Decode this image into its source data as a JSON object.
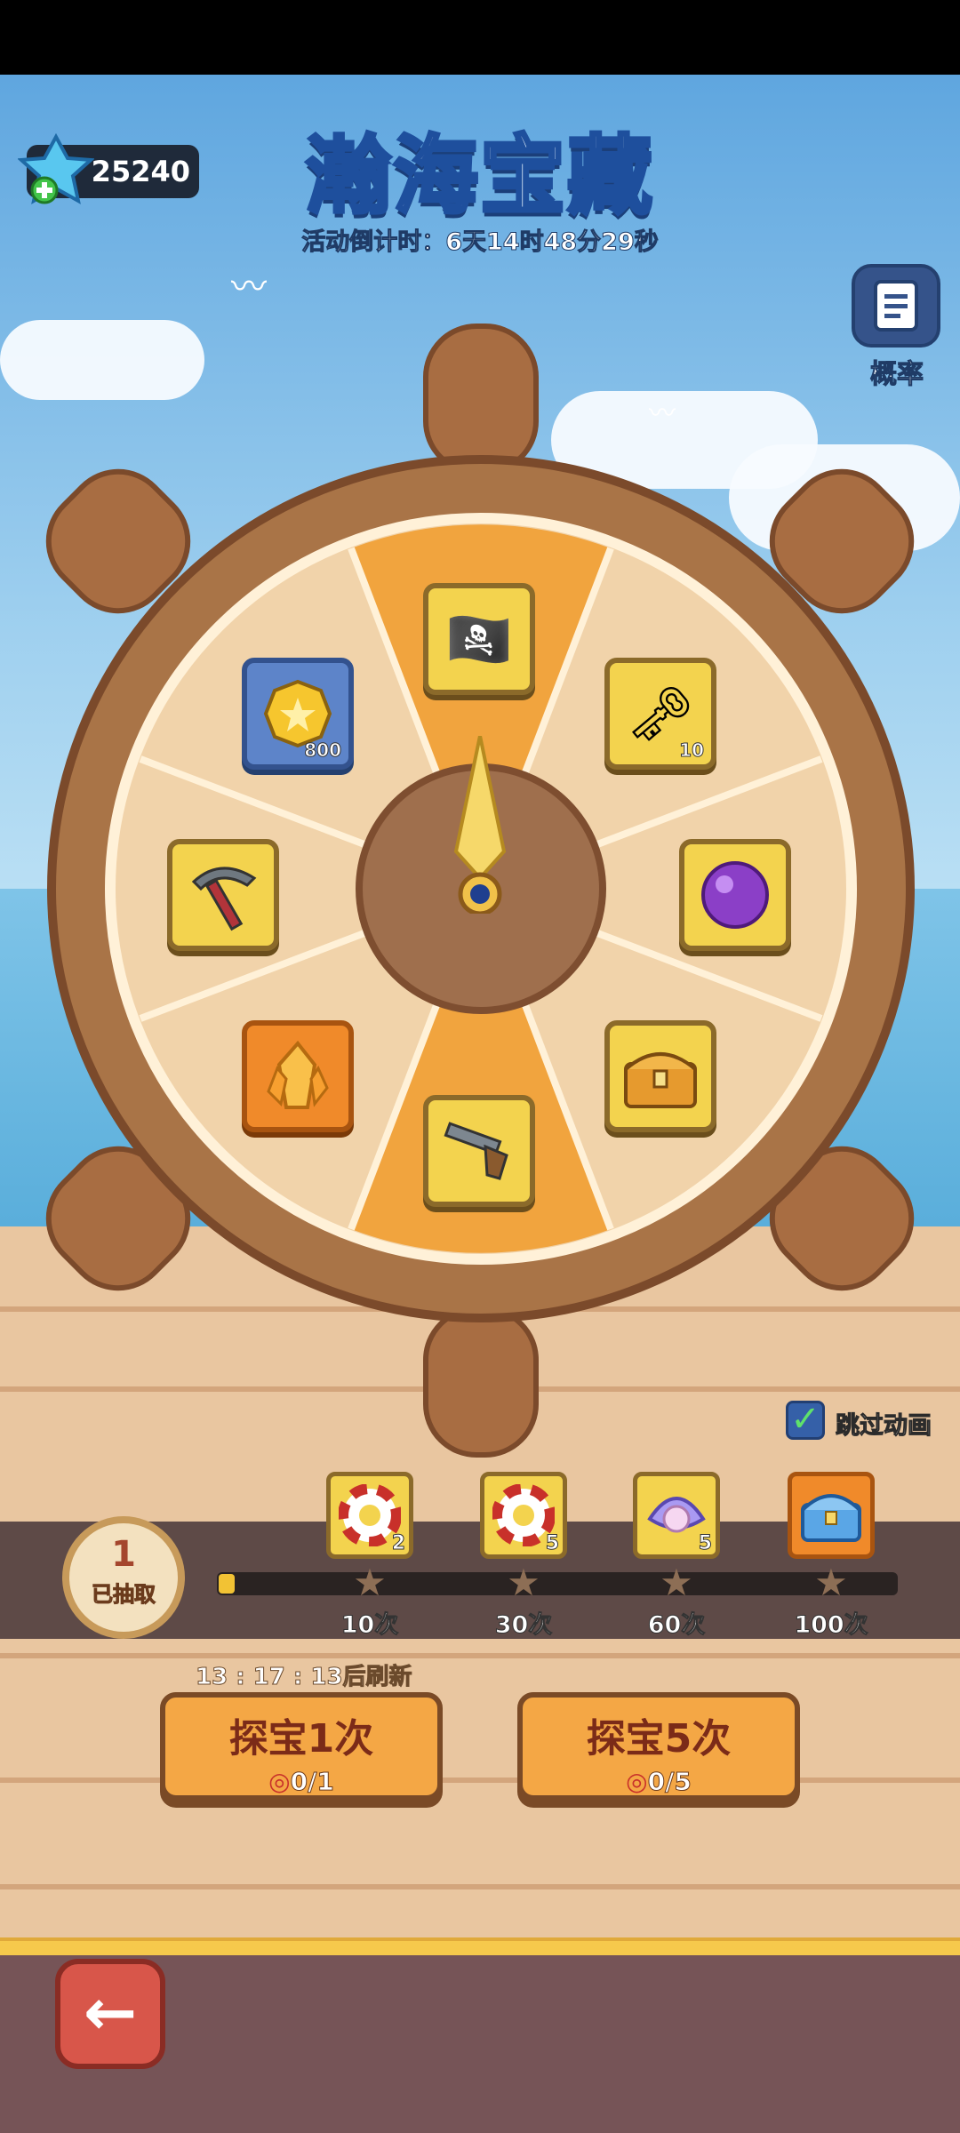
{
  "currency": {
    "icon": "gem-plus-icon",
    "amount": "25240"
  },
  "header": {
    "title": "瀚海宝藏",
    "countdown": "活动倒计时：6天14时48分29秒"
  },
  "probability": {
    "icon": "document-icon",
    "label": "概率"
  },
  "wheel": {
    "slots": [
      {
        "name": "pirate-hero",
        "icon": "pirate-character-icon",
        "count": ""
      },
      {
        "name": "golden-key",
        "icon": "golden-key-icon",
        "count": "10"
      },
      {
        "name": "purple-orb",
        "icon": "purple-orb-icon",
        "count": ""
      },
      {
        "name": "treasure-chest",
        "icon": "treasure-chest-icon",
        "count": ""
      },
      {
        "name": "flintlock-pistol",
        "icon": "pistol-icon",
        "count": ""
      },
      {
        "name": "orange-crystal",
        "icon": "crystal-icon",
        "count": ""
      },
      {
        "name": "pickaxe",
        "icon": "pickaxe-icon",
        "count": ""
      },
      {
        "name": "gold-coin",
        "icon": "coin-icon",
        "count": "800"
      }
    ]
  },
  "skip": {
    "label": "跳过动画",
    "checked": true
  },
  "progress": {
    "current_draws": "1",
    "draw_label": "已抽取",
    "fill_fraction": 0.01,
    "milestones": [
      {
        "label": "10次",
        "reward_icon": "life-ring-icon",
        "reward_count": "2"
      },
      {
        "label": "30次",
        "reward_icon": "life-ring-icon",
        "reward_count": "5"
      },
      {
        "label": "60次",
        "reward_icon": "pearl-shell-icon",
        "reward_count": "5"
      },
      {
        "label": "100次",
        "reward_icon": "blue-chest-icon",
        "reward_count": ""
      }
    ]
  },
  "refresh": {
    "text": "13 : 17 : 13后刷新"
  },
  "actions": [
    {
      "label": "探宝1次",
      "cost": "0/1",
      "cost_icon": "life-ring-icon"
    },
    {
      "label": "探宝5次",
      "cost": "0/5",
      "cost_icon": "life-ring-icon"
    }
  ],
  "back": {
    "icon": "back-arrow-icon"
  }
}
